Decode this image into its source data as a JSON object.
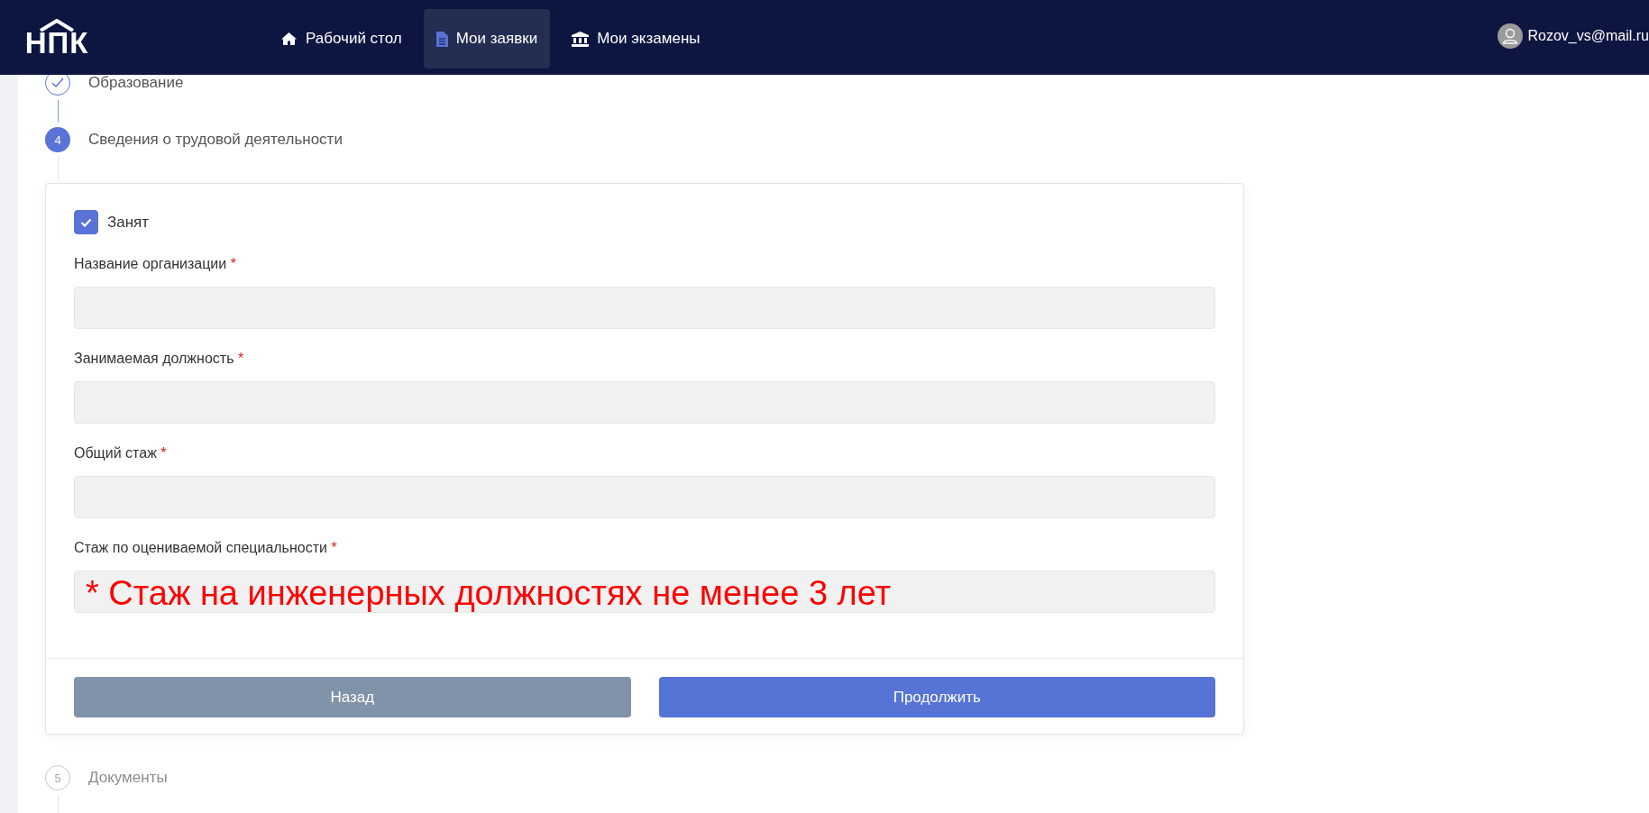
{
  "header": {
    "logo": "НПК",
    "nav": [
      {
        "label": "Рабочий стол",
        "selected": false
      },
      {
        "label": "Мои заявки",
        "selected": true
      },
      {
        "label": "Мои экзамены",
        "selected": false
      }
    ],
    "user": "Rozov_vs@mail.ru"
  },
  "steps_before": [
    {
      "label": "Образование",
      "kind": "done"
    },
    {
      "number": "4",
      "label": "Сведения о трудовой деятельности",
      "kind": "active"
    }
  ],
  "form": {
    "employed": {
      "label": "Занят",
      "checked": true
    },
    "fields": [
      {
        "label": "Название организации",
        "required_mark": "*"
      },
      {
        "label": "Занимаемая должность",
        "required_mark": "*"
      },
      {
        "label": "Общий стаж",
        "required_mark": "*"
      },
      {
        "label": "Стаж по оцениваемой специальности",
        "required_mark": "*"
      }
    ],
    "annotation": "* Стаж на инженерных должностях не менее 3 лет",
    "buttons": [
      {
        "label": "Назад",
        "kind": "secondary"
      },
      {
        "label": "Продолжить",
        "kind": "primary"
      }
    ]
  },
  "steps_after": [
    {
      "number": "5",
      "label": "Документы",
      "kind": "pending"
    }
  ]
}
